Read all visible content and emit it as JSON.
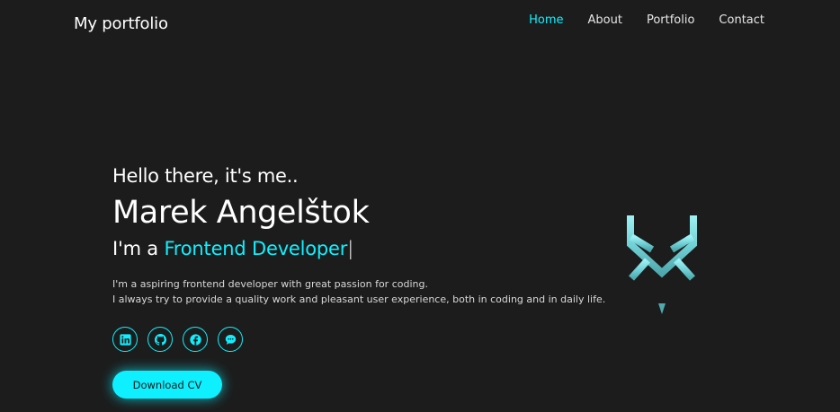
{
  "header": {
    "logo": "My portfolio",
    "nav": [
      {
        "label": "Home",
        "active": true
      },
      {
        "label": "About",
        "active": false
      },
      {
        "label": "Portfolio",
        "active": false
      },
      {
        "label": "Contact",
        "active": false
      }
    ]
  },
  "hero": {
    "greeting": "Hello there, it's me..",
    "name": "Marek Angelštok",
    "role_prefix": "I'm a ",
    "role_highlight": "Frontend Developer",
    "cursor": "|",
    "description_line1": "I'm a aspiring frontend developer with great passion for coding.",
    "description_line2": "I always try to provide a quality work and pleasant user experience, both in coding and in daily life.",
    "socials": [
      "linkedin-icon",
      "github-icon",
      "facebook-icon",
      "chat-icon"
    ],
    "cv_button": "Download CV"
  },
  "colors": {
    "background": "#1c1c1c",
    "accent": "#0ef0ff",
    "text": "#ffffff"
  }
}
